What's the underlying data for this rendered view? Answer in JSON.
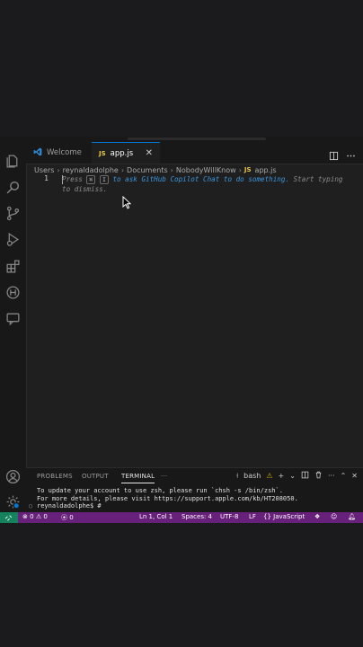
{
  "tabs": {
    "welcome": "Welcome",
    "app": "app.js"
  },
  "breadcrumb": [
    "Users",
    "reynaldadolphe",
    "Documents",
    "NobodyWillKnow",
    "app.js"
  ],
  "breadcrumb_file_icon": "JS",
  "editor": {
    "line_number": "1",
    "hint": {
      "press": "Press",
      "key1": "⌘",
      "key2": "I",
      "middle": "to ask GitHub Copilot Chat to do something.",
      "end": "Start typing to dismiss."
    }
  },
  "panel": {
    "tabs": [
      "PROBLEMS",
      "OUTPUT",
      "TERMINAL"
    ],
    "more": "···",
    "shell": "bash",
    "terminal_lines": [
      "To update your account to use zsh, please run `chsh -s /bin/zsh`.",
      "For more details, please visit https://support.apple.com/kb/HT208050.",
      "reynaldadolphe$ #"
    ]
  },
  "status": {
    "errors": "0",
    "warnings": "0",
    "ports": "0",
    "position": "Ln 1, Col 1",
    "spaces": "Spaces: 4",
    "encoding": "UTF-8",
    "eol": "LF",
    "language": "JavaScript"
  },
  "icons": {
    "activity": [
      "explorer-icon",
      "search-icon",
      "source-control-icon",
      "run-debug-icon",
      "extensions-icon",
      "remote-explorer-icon",
      "chat-icon",
      "account-icon",
      "settings-gear-icon"
    ]
  },
  "colors": {
    "accent": "#0078d4",
    "statusbar": "#68217a",
    "remote": "#16825d"
  }
}
